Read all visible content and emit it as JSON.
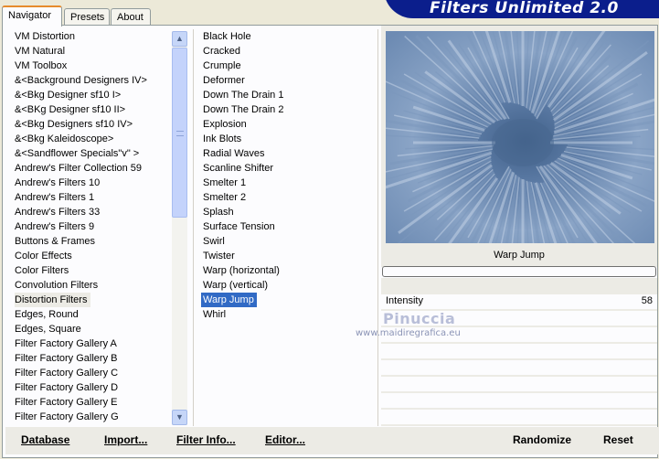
{
  "tabs": [
    {
      "label": "Navigator",
      "active": true
    },
    {
      "label": "Presets",
      "active": false
    },
    {
      "label": "About",
      "active": false
    }
  ],
  "brand": {
    "title": "Filters Unlimited 2.0",
    "color": "#0b1e8c"
  },
  "categories": {
    "items": [
      "VM Distortion",
      "VM Natural",
      "VM Toolbox",
      "&<Background Designers IV>",
      "&<Bkg Designer sf10 I>",
      "&<BKg Designer sf10 II>",
      "&<Bkg Designers sf10 IV>",
      "&<Bkg Kaleidoscope>",
      "&<Sandflower Specials\"v\" >",
      "Andrew's Filter Collection 59",
      "Andrew's Filters 10",
      "Andrew's Filters 1",
      "Andrew's Filters 33",
      "Andrew's Filters 9",
      "Buttons & Frames",
      "Color Effects",
      "Color Filters",
      "Convolution Filters",
      "Distortion Filters",
      "Edges, Round",
      "Edges, Square",
      "Filter Factory Gallery A",
      "Filter Factory Gallery B",
      "Filter Factory Gallery C",
      "Filter Factory Gallery D",
      "Filter Factory Gallery E",
      "Filter Factory Gallery G"
    ],
    "selected": "Distortion Filters"
  },
  "filters": {
    "items": [
      "Black Hole",
      "Cracked",
      "Crumple",
      "Deformer",
      "Down The Drain 1",
      "Down The Drain 2",
      "Explosion",
      "Ink Blots",
      "Radial Waves",
      "Scanline Shifter",
      "Smelter 1",
      "Smelter 2",
      "Splash",
      "Surface Tension",
      "Swirl",
      "Twister",
      "Warp (horizontal)",
      "Warp (vertical)",
      "Warp Jump",
      "Whirl"
    ],
    "selected": "Warp Jump",
    "selection_color": "#316ac5"
  },
  "preview": {
    "filter_name": "Warp Jump"
  },
  "parameters": [
    {
      "label": "Intensity",
      "value": "58"
    }
  ],
  "watermark": {
    "name": "Pinuccia",
    "url": "www.maidiregrafica.eu"
  },
  "buttons": {
    "database": "Database",
    "import": "Import...",
    "filter_info": "Filter Info...",
    "editor": "Editor...",
    "randomize": "Randomize",
    "reset": "Reset"
  },
  "icons": {
    "scroll_up": "▲",
    "scroll_down": "▼"
  }
}
